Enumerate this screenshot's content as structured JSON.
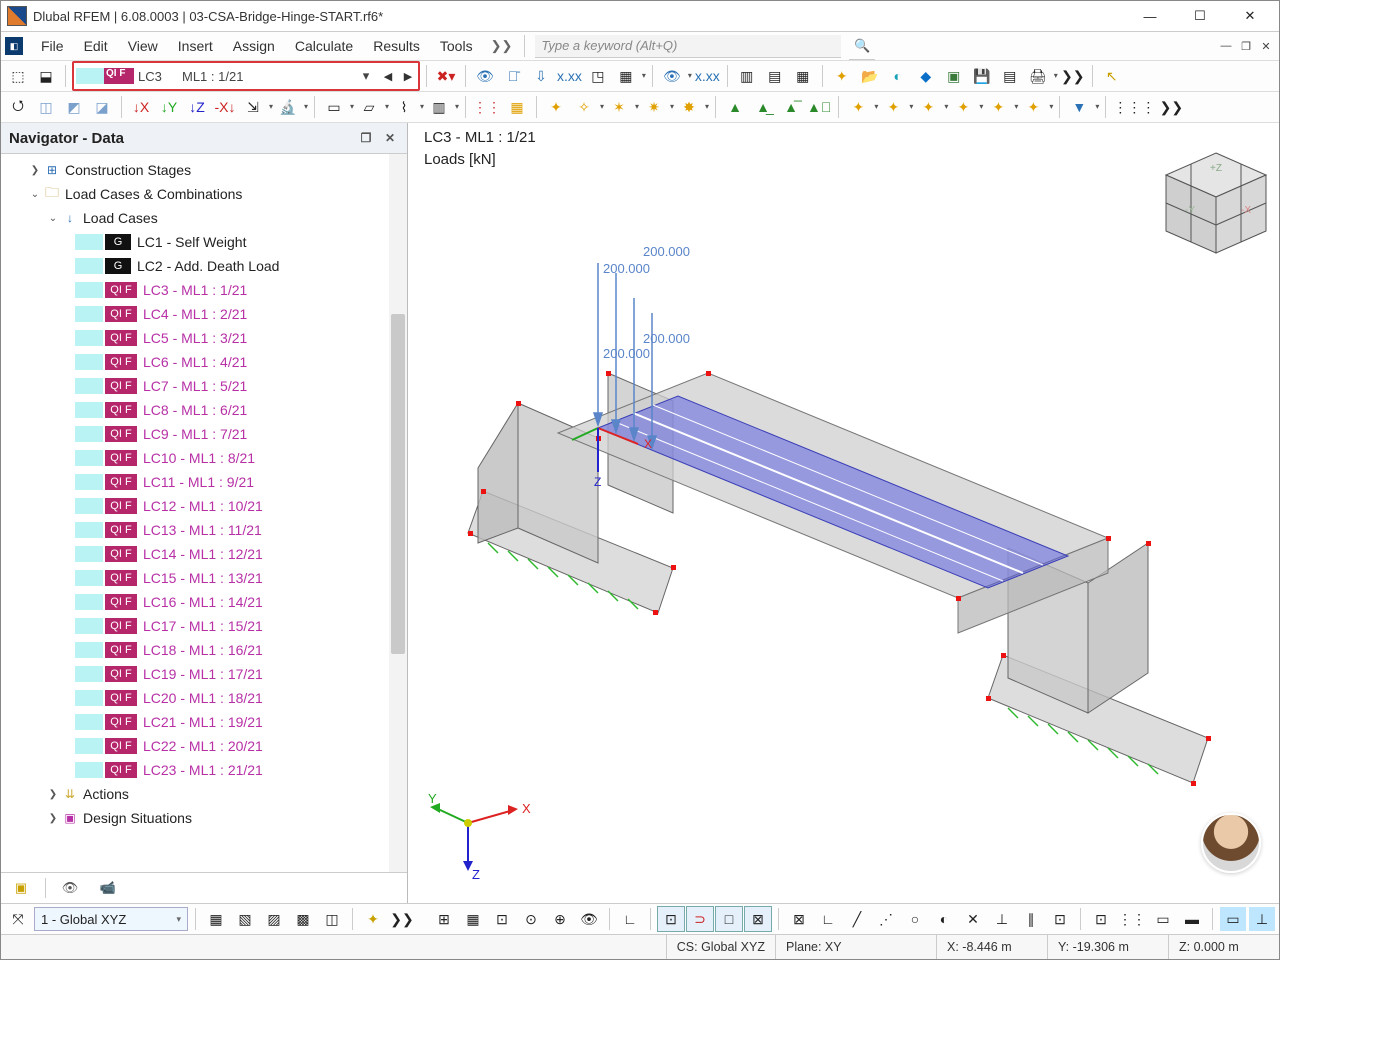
{
  "window": {
    "title": "Dlubal RFEM | 6.08.0003 | 03-CSA-Bridge-Hinge-START.rf6*"
  },
  "menubar": {
    "items": [
      "File",
      "Edit",
      "View",
      "Insert",
      "Assign",
      "Calculate",
      "Results",
      "Tools"
    ],
    "more": "❯❯",
    "search_placeholder": "Type a keyword (Alt+Q)"
  },
  "loadcase_toolbar": {
    "qi": "QI F",
    "lc": "LC3",
    "ml": "ML1 : 1/21"
  },
  "viewport": {
    "title": "LC3 - ML1 : 1/21",
    "subtitle": "Loads [kN]",
    "loads": [
      "200.000",
      "200.000",
      "200.000",
      "200.000"
    ],
    "axes": {
      "x": "X",
      "y": "Y",
      "z": "Z"
    }
  },
  "navigator": {
    "title": "Navigator - Data",
    "nodes": {
      "construction_stages": "Construction Stages",
      "load_cases_comb": "Load Cases & Combinations",
      "load_cases": "Load Cases",
      "actions": "Actions",
      "design_situations": "Design Situations"
    },
    "lc_rows": [
      {
        "tag": "G",
        "label": "LC1 - Self Weight",
        "m": false
      },
      {
        "tag": "G",
        "label": "LC2 - Add. Death Load",
        "m": false
      },
      {
        "tag": "QI F",
        "label": "LC3 - ML1 : 1/21",
        "m": true
      },
      {
        "tag": "QI F",
        "label": "LC4 - ML1 : 2/21",
        "m": true
      },
      {
        "tag": "QI F",
        "label": "LC5 - ML1 : 3/21",
        "m": true
      },
      {
        "tag": "QI F",
        "label": "LC6 - ML1 : 4/21",
        "m": true
      },
      {
        "tag": "QI F",
        "label": "LC7 - ML1 : 5/21",
        "m": true
      },
      {
        "tag": "QI F",
        "label": "LC8 - ML1 : 6/21",
        "m": true
      },
      {
        "tag": "QI F",
        "label": "LC9 - ML1 : 7/21",
        "m": true
      },
      {
        "tag": "QI F",
        "label": "LC10 - ML1 : 8/21",
        "m": true
      },
      {
        "tag": "QI F",
        "label": "LC11 - ML1 : 9/21",
        "m": true
      },
      {
        "tag": "QI F",
        "label": "LC12 - ML1 : 10/21",
        "m": true
      },
      {
        "tag": "QI F",
        "label": "LC13 - ML1 : 11/21",
        "m": true
      },
      {
        "tag": "QI F",
        "label": "LC14 - ML1 : 12/21",
        "m": true
      },
      {
        "tag": "QI F",
        "label": "LC15 - ML1 : 13/21",
        "m": true
      },
      {
        "tag": "QI F",
        "label": "LC16 - ML1 : 14/21",
        "m": true
      },
      {
        "tag": "QI F",
        "label": "LC17 - ML1 : 15/21",
        "m": true
      },
      {
        "tag": "QI F",
        "label": "LC18 - ML1 : 16/21",
        "m": true
      },
      {
        "tag": "QI F",
        "label": "LC19 - ML1 : 17/21",
        "m": true
      },
      {
        "tag": "QI F",
        "label": "LC20 - ML1 : 18/21",
        "m": true
      },
      {
        "tag": "QI F",
        "label": "LC21 - ML1 : 19/21",
        "m": true
      },
      {
        "tag": "QI F",
        "label": "LC22 - ML1 : 20/21",
        "m": true
      },
      {
        "tag": "QI F",
        "label": "LC23 - ML1 : 21/21",
        "m": true
      }
    ]
  },
  "bottom": {
    "coord_system": "1 - Global XYZ"
  },
  "status": {
    "cs": "CS: Global XYZ",
    "plane": "Plane: XY",
    "x": "X: -8.446 m",
    "y": "Y: -19.306 m",
    "z": "Z: 0.000 m"
  }
}
